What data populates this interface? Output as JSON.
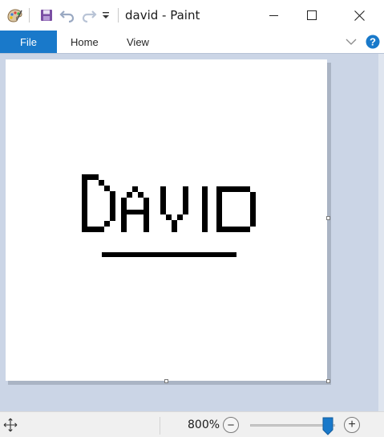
{
  "window": {
    "title": "david - Paint"
  },
  "quick_access": {
    "icons": [
      "paint-app-icon",
      "save-icon",
      "undo-icon",
      "redo-icon",
      "customize-dropdown-icon"
    ]
  },
  "ribbon": {
    "tabs": [
      {
        "label": "File",
        "active": true
      },
      {
        "label": "Home",
        "active": false
      },
      {
        "label": "View",
        "active": false
      }
    ],
    "help_glyph": "?",
    "accent_color": "#1979ca"
  },
  "canvas_art": {
    "text": "DAVID",
    "underline": true
  },
  "status": {
    "zoom_label": "800%",
    "zoom_percent": 800,
    "zoom_out_glyph": "−",
    "zoom_in_glyph": "+"
  }
}
